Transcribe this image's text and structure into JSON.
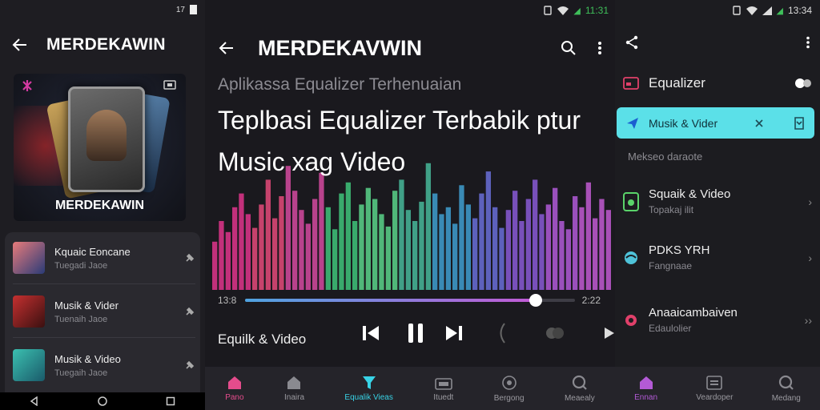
{
  "panel1": {
    "status": {
      "time": "17"
    },
    "header": {
      "title": "MERDEKAWIN"
    },
    "album": {
      "name": "MERDEKAWIN"
    },
    "list": [
      {
        "title": "Kquaic Eoncane",
        "subtitle": "Tuegadi Jaoe"
      },
      {
        "title": "Musik & Vider",
        "subtitle": "Tuenaih Jaoe"
      },
      {
        "title": "Musik & Video",
        "subtitle": "Tuegaih Jaoe"
      }
    ]
  },
  "panel2": {
    "status": {
      "time": "11:31"
    },
    "header": {
      "title": "MERDEKAVWIN"
    },
    "subtitle": "Aplikassa Equalizer Terhenuaian",
    "headline_line1": "Teplbasi Equalizer Terbabik ptur",
    "headline_line2": "Music xag Video",
    "player": {
      "elapsed": "13:8",
      "duration": "2:22",
      "progress": 0.88,
      "now_playing": "Equilk & Video"
    },
    "bars": [
      0.35,
      0.5,
      0.42,
      0.6,
      0.7,
      0.55,
      0.45,
      0.62,
      0.8,
      0.52,
      0.68,
      0.9,
      0.72,
      0.58,
      0.48,
      0.66,
      0.85,
      0.6,
      0.44,
      0.7,
      0.78,
      0.5,
      0.62,
      0.74,
      0.66,
      0.55,
      0.46,
      0.72,
      0.8,
      0.58,
      0.5,
      0.64,
      0.92,
      0.7,
      0.55,
      0.6,
      0.48,
      0.76,
      0.62,
      0.52,
      0.7,
      0.86,
      0.6,
      0.45,
      0.58,
      0.72,
      0.5,
      0.66,
      0.8,
      0.55,
      0.62,
      0.74,
      0.5,
      0.44,
      0.68,
      0.6,
      0.78,
      0.52,
      0.66,
      0.58
    ],
    "bottom_nav": [
      {
        "label": "Pano",
        "icon": "home-icon",
        "active": false
      },
      {
        "label": "Inaira",
        "icon": "house-icon",
        "active": false
      },
      {
        "label": "Equalik Vieas",
        "icon": "equalizer-icon",
        "active": true
      },
      {
        "label": "Ituedt",
        "icon": "radio-icon",
        "active": false
      },
      {
        "label": "Bergong",
        "icon": "record-icon",
        "active": false
      },
      {
        "label": "Meaealy",
        "icon": "search-icon",
        "active": false
      }
    ]
  },
  "panel3": {
    "status": {
      "time": "13:34"
    },
    "equalizer_label": "Equalizer",
    "active_item": {
      "label": "Musik & Vider"
    },
    "section_label": "Mekseo daraote",
    "items": [
      {
        "title": "Squaik & Video",
        "subtitle": "Topakaj ilit",
        "icon_color": "#5ad36a",
        "chevron": "›"
      },
      {
        "title": "PDKS YRH",
        "subtitle": "Fangnaae",
        "icon_color": "#4fc3d9",
        "chevron": "›"
      },
      {
        "title": "Anaaicambaiven",
        "subtitle": "Edaulolier",
        "icon_color": "#e0406a",
        "chevron": "››"
      }
    ],
    "bottom_nav": [
      {
        "label": "Ennan",
        "icon": "home-icon",
        "active": true
      },
      {
        "label": "Veardoper",
        "icon": "radio-icon",
        "active": false
      },
      {
        "label": "Medang",
        "icon": "search-icon",
        "active": false
      }
    ]
  }
}
